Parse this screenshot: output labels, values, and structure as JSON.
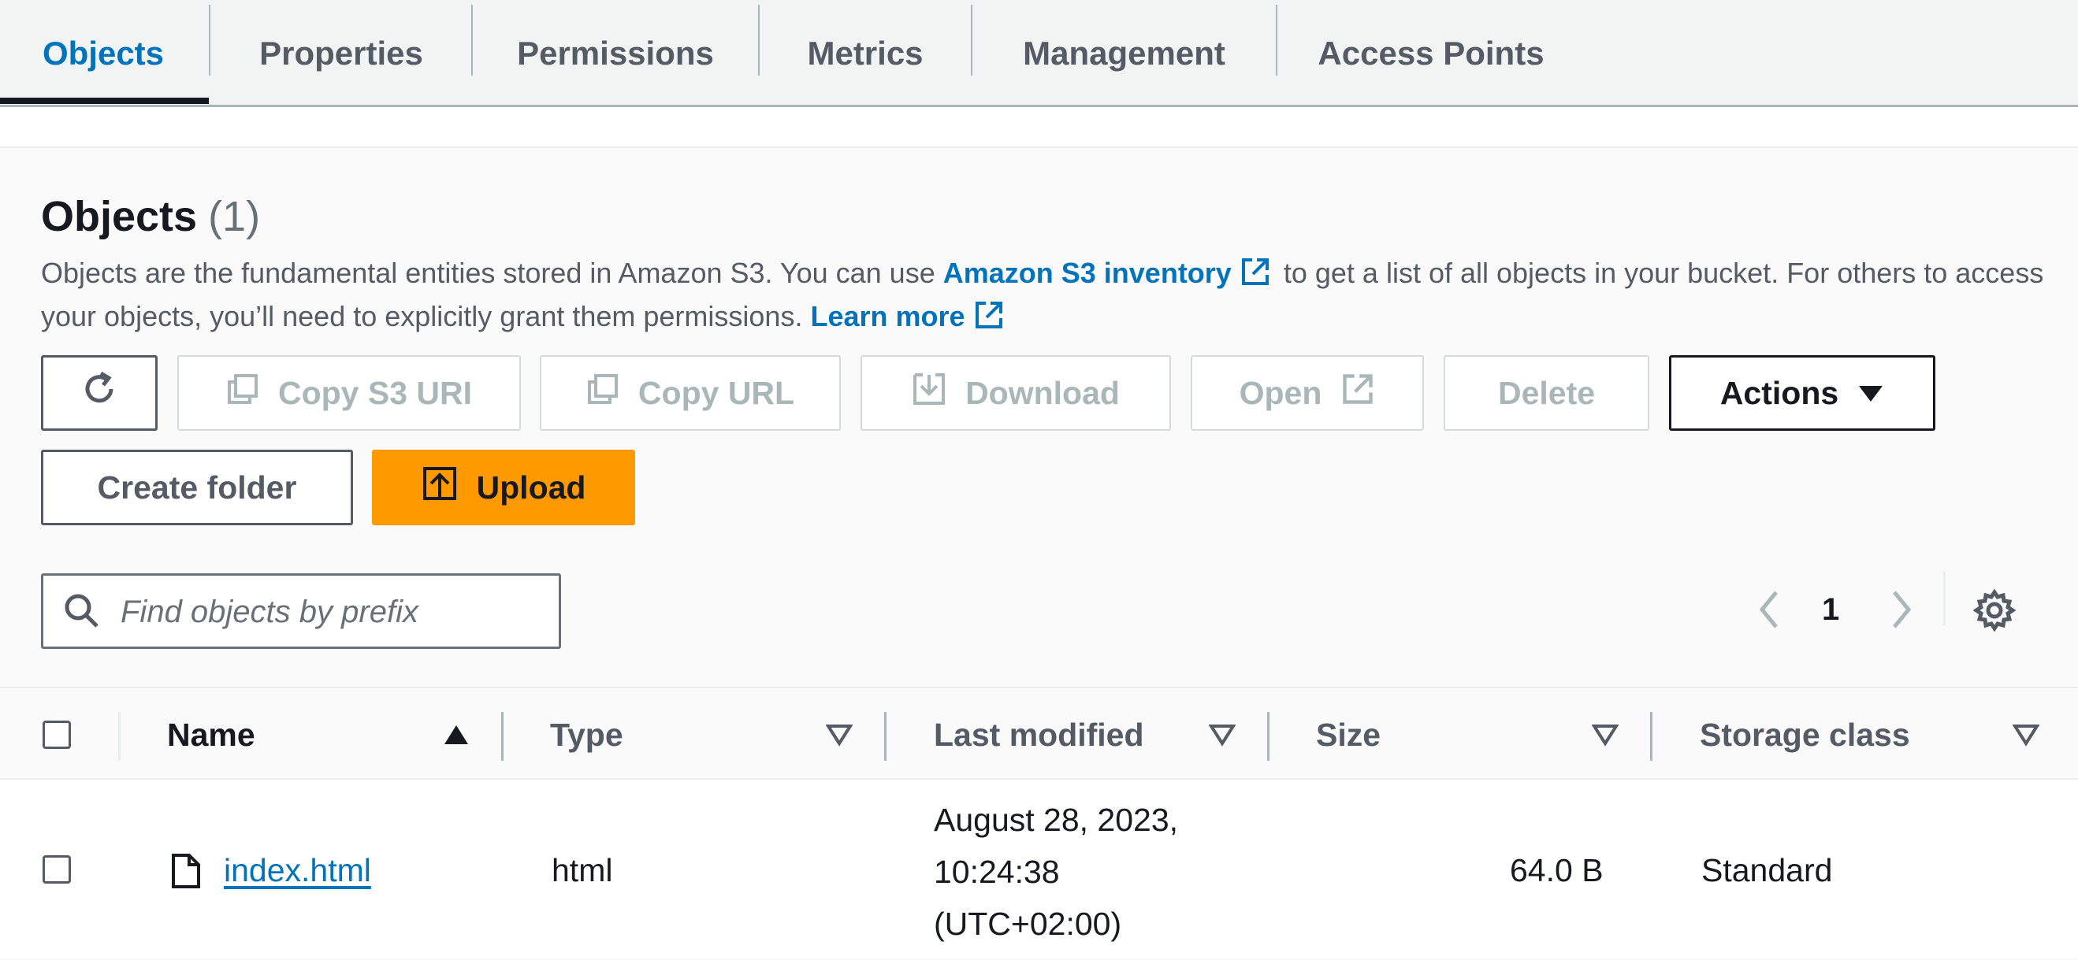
{
  "tabs": [
    {
      "label": "Objects",
      "active": true
    },
    {
      "label": "Properties"
    },
    {
      "label": "Permissions"
    },
    {
      "label": "Metrics"
    },
    {
      "label": "Management"
    },
    {
      "label": "Access Points"
    }
  ],
  "objects": {
    "title": "Objects",
    "count": "(1)",
    "description_part1": "Objects are the fundamental entities stored in Amazon S3. You can use",
    "inventory_link": "Amazon S3 inventory",
    "description_part2": "to get a list of all objects in your bucket. For others to access your objects, you’ll need to explicitly grant them permissions.",
    "learn_more": "Learn more"
  },
  "toolbar": {
    "copy_s3_uri": "Copy S3 URI",
    "copy_url": "Copy URL",
    "download": "Download",
    "open": "Open",
    "delete": "Delete",
    "actions": "Actions",
    "create_folder": "Create folder",
    "upload": "Upload"
  },
  "search": {
    "placeholder": "Find objects by prefix"
  },
  "pagination": {
    "current_page": "1"
  },
  "table": {
    "columns": [
      "Name",
      "Type",
      "Last modified",
      "Size",
      "Storage class"
    ],
    "rows": [
      {
        "name": "index.html",
        "type": "html",
        "last_modified_line1": "August 28, 2023,",
        "last_modified_line2": "10:24:38",
        "last_modified_line3": "(UTC+02:00)",
        "size": "64.0 B",
        "storage_class": "Standard"
      }
    ]
  },
  "colors": {
    "accent_link": "#0073bb",
    "primary_button": "#ff9900",
    "text_dark": "#16191f",
    "text_muted": "#545b64",
    "disabled": "#aab7b8"
  }
}
